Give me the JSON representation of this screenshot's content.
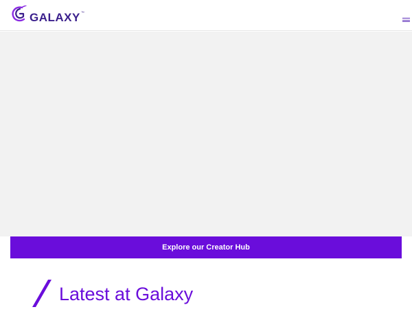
{
  "header": {
    "logo_text": "GALAXY",
    "logo_trademark": "™",
    "logo_icon": "galaxy-swoosh-logo",
    "menu_icon": "hamburger-menu-icon"
  },
  "hero": {
    "media": "empty-video-placeholder"
  },
  "cta": {
    "label": "Explore our Creator Hub"
  },
  "section": {
    "title": "Latest at Galaxy",
    "decoration_icon": "slash-accent-icon"
  },
  "colors": {
    "brand_purple": "#6a0ddb",
    "logo_navy": "#3a1f8c",
    "hero_background": "#f2f2f2",
    "header_border": "#e6e6e6"
  }
}
